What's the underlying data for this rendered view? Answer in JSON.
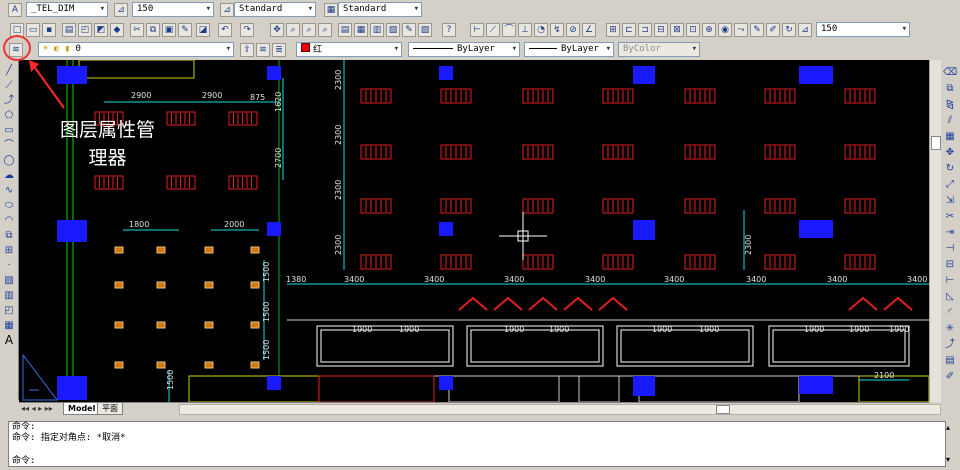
{
  "toolbar_top": {
    "textstyle_value": "_TEL_DIM",
    "dimscale_value": "150",
    "dimstyle_value": "Standard",
    "tablestyle_value": "Standard",
    "scale_value": "150"
  },
  "layer_bar": {
    "layer_name": "0",
    "color_value": "红",
    "linetype_value": "ByLayer",
    "lineweight_value": "ByLayer",
    "plotstyle_value": "ByColor"
  },
  "annotation": {
    "line1": "图层属性管",
    "line2": "理器"
  },
  "drawing": {
    "dims": {
      "d2900a": "2900",
      "d2900b": "2900",
      "d875": "875",
      "d1620": "1620",
      "d2700": "2700",
      "d1800": "1800",
      "d2000": "2000",
      "d1500a": "1500",
      "d1500b": "1500",
      "d1500c": "1500",
      "d2300a": "2300",
      "d2300b": "2300",
      "d2300c": "2300",
      "d2300d": "2300",
      "d2300e": "2300",
      "d1380": "1380",
      "d3400_1": "3400",
      "d3400_2": "3400",
      "d3400_3": "3400",
      "d3400_4": "3400",
      "d3400_5": "3400",
      "d3400_6": "3400",
      "d3400_7": "3400",
      "d3400_8": "3400",
      "d1900_1": "1900",
      "d1900_2": "1900",
      "d1900_3": "1900",
      "d1900_4": "1900",
      "d1900_5": "1900",
      "d1900_6": "1900",
      "d1900_7": "1900",
      "d1900_8": "1900",
      "d1900_9": "1900",
      "d2100": "2100"
    },
    "colors": {
      "grille": "#e02020",
      "column": "#1a1aff",
      "dim": "#19e0e0",
      "wall": "#00e000"
    }
  },
  "tabs": {
    "model": "Model",
    "layout": "平面"
  },
  "command": {
    "line1": "命令:",
    "line2": "命令: 指定对角点: *取消*",
    "line3": "命令:"
  }
}
